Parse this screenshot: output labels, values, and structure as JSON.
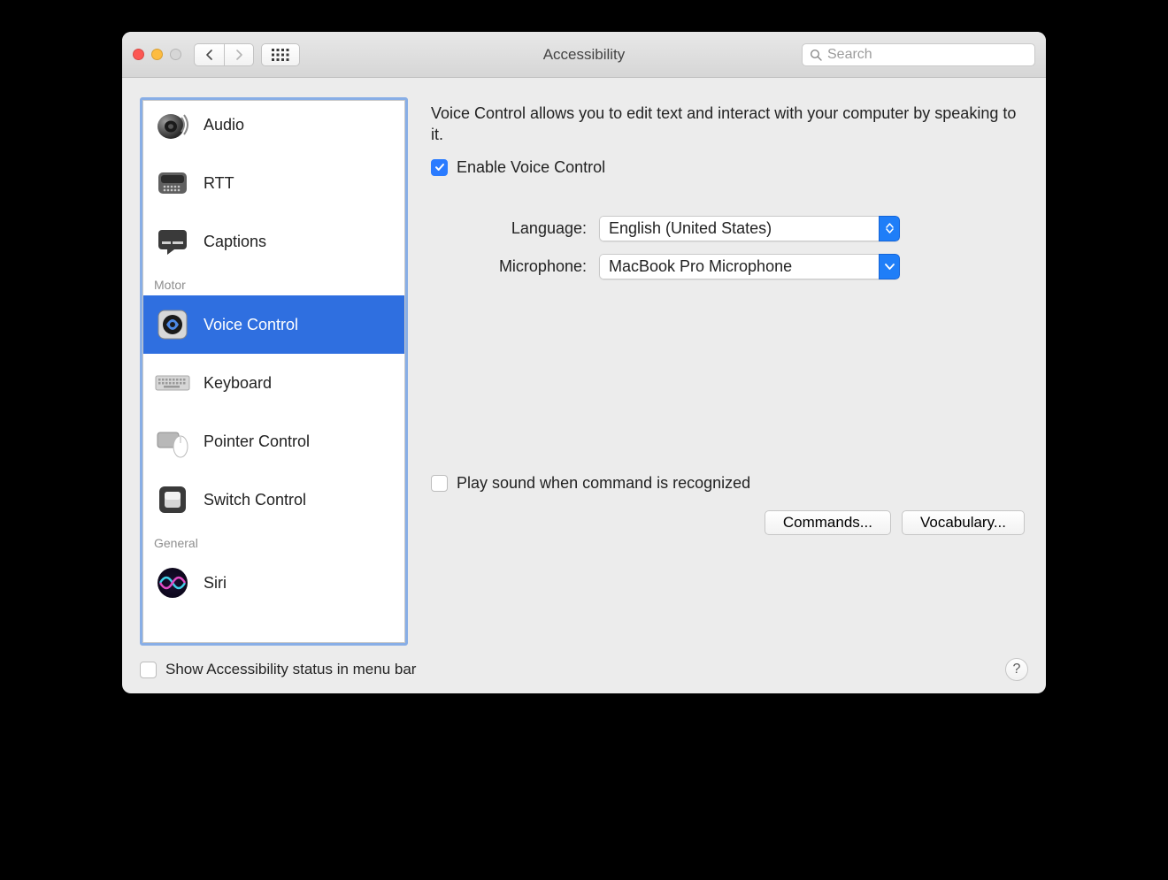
{
  "window": {
    "title": "Accessibility"
  },
  "search": {
    "placeholder": "Search"
  },
  "sidebar": {
    "groups": [
      {
        "header": "",
        "items": [
          {
            "label": "Audio"
          },
          {
            "label": "RTT"
          },
          {
            "label": "Captions"
          }
        ]
      },
      {
        "header": "Motor",
        "items": [
          {
            "label": "Voice Control",
            "selected": true
          },
          {
            "label": "Keyboard"
          },
          {
            "label": "Pointer Control"
          },
          {
            "label": "Switch Control"
          }
        ]
      },
      {
        "header": "General",
        "items": [
          {
            "label": "Siri"
          }
        ]
      }
    ]
  },
  "main": {
    "description": "Voice Control allows you to edit text and interact with your computer by speaking to it.",
    "enable_label": "Enable Voice Control",
    "enable_checked": true,
    "language_label": "Language:",
    "language_value": "English (United States)",
    "microphone_label": "Microphone:",
    "microphone_value": "MacBook Pro Microphone",
    "playsound_label": "Play sound when command is recognized",
    "playsound_checked": false,
    "commands_button": "Commands...",
    "vocabulary_button": "Vocabulary..."
  },
  "footer": {
    "status_label": "Show Accessibility status in menu bar",
    "status_checked": false
  }
}
